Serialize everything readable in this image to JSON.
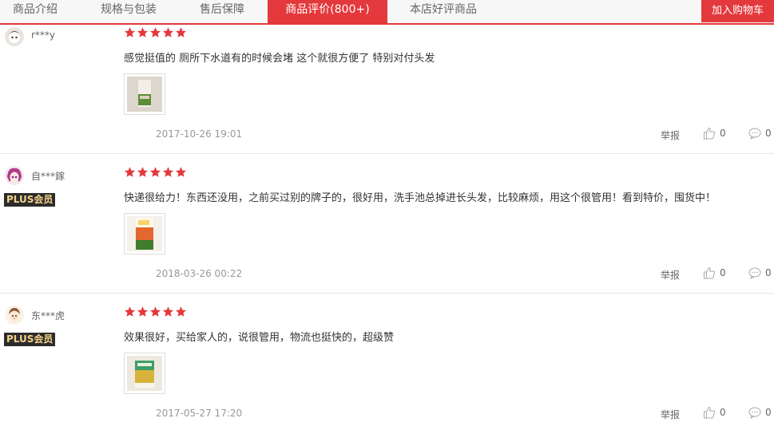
{
  "tabs": [
    {
      "label": "商品介绍"
    },
    {
      "label": "规格与包装"
    },
    {
      "label": "售后保障"
    },
    {
      "label": "商品评价(800+)",
      "active": true
    },
    {
      "label": "本店好评商品"
    }
  ],
  "cart_button": "加入购物车",
  "actions": {
    "report": "举报"
  },
  "reviews": [
    {
      "username": "r***y",
      "plus": "",
      "rating": 5,
      "comment": "感觉挺值的 厕所下水道有的时候会堵 这个就很方便了 特别对付头发",
      "date": "2017-10-26 19:01",
      "likes": "0",
      "replies": "0"
    },
    {
      "username": "自***鎵",
      "plus": "PLUS会员",
      "rating": 5,
      "comment": "快递很给力！东西还没用，之前买过别的牌子的，很好用，洗手池总掉进长头发，比较麻烦，用这个很管用！看到特价，囤货中！",
      "date": "2018-03-26 00:22",
      "likes": "0",
      "replies": "0"
    },
    {
      "username": "东***虎",
      "plus": "PLUS会员",
      "rating": 5,
      "comment": "效果很好，买给家人的，说很管用，物流也挺快的，超级赞",
      "date": "2017-05-27 17:20",
      "likes": "0",
      "replies": "0"
    }
  ],
  "colors": {
    "accent": "#e4393c",
    "star": "#e4393c",
    "plus_bg": "#2c2c2c",
    "plus_text": "#f5d28b"
  }
}
